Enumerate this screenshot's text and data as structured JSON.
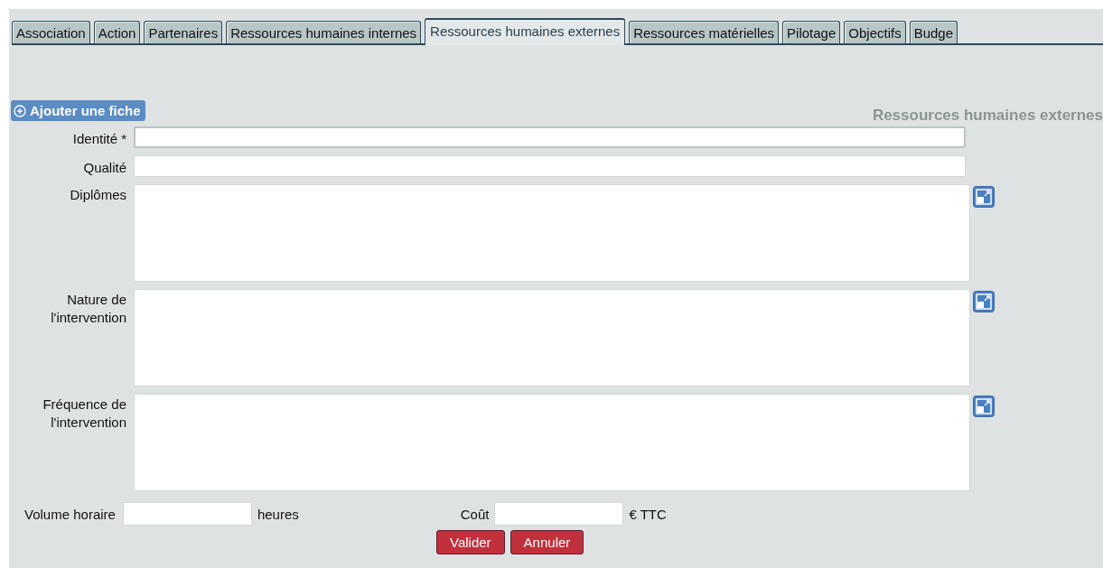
{
  "tabs": [
    {
      "label": "Association",
      "selected": false
    },
    {
      "label": "Action",
      "selected": false
    },
    {
      "label": "Partenaires",
      "selected": false
    },
    {
      "label": "Ressources humaines internes",
      "selected": false
    },
    {
      "label": "Ressources humaines externes",
      "selected": true
    },
    {
      "label": "Ressources matérielles",
      "selected": false
    },
    {
      "label": "Pilotage",
      "selected": false
    },
    {
      "label": "Objectifs",
      "selected": false
    },
    {
      "label": "Budge",
      "selected": false
    }
  ],
  "add_button": {
    "label": "Ajouter une fiche"
  },
  "section_title": "Ressources humaines externes",
  "fields": [
    {
      "kind": "input",
      "label": "Identité *",
      "focused": true
    },
    {
      "kind": "input",
      "label": "Qualité",
      "focused": false
    },
    {
      "kind": "textarea",
      "label": "Diplômes"
    },
    {
      "kind": "textarea",
      "label": "Nature de l'intervention"
    },
    {
      "kind": "textarea",
      "label": "Fréquence de l'intervention"
    }
  ],
  "hours": {
    "label": "Volume horaire",
    "unit": "heures"
  },
  "cost": {
    "label": "Coût",
    "unit": "€ TTC"
  },
  "buttons": [
    "Valider",
    "Annuler"
  ]
}
